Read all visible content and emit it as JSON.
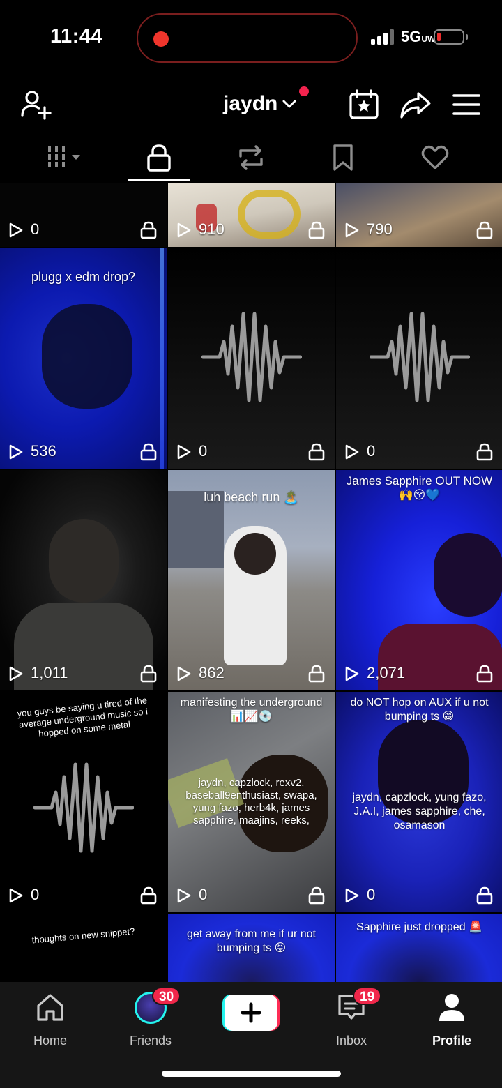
{
  "status_bar": {
    "time": "11:44",
    "network": "5G",
    "network_suffix": "UW",
    "battery_level": 0.1
  },
  "header": {
    "username": "jaydn",
    "icons": [
      "add-friend-icon",
      "calendar-star-icon",
      "share-icon",
      "menu-icon"
    ]
  },
  "tabs": [
    {
      "name": "videos",
      "icon": "grid-icon"
    },
    {
      "name": "private",
      "icon": "lock-icon",
      "active": true
    },
    {
      "name": "reposts",
      "icon": "repost-icon"
    },
    {
      "name": "favorites",
      "icon": "bookmark-icon"
    },
    {
      "name": "liked",
      "icon": "heart-icon"
    }
  ],
  "videos": [
    {
      "count": "0",
      "caption": ""
    },
    {
      "count": "910",
      "caption": ""
    },
    {
      "count": "790",
      "caption": ""
    },
    {
      "count": "536",
      "caption": "plugg x edm drop?"
    },
    {
      "count": "0",
      "caption": ""
    },
    {
      "count": "0",
      "caption": ""
    },
    {
      "count": "1,011",
      "caption": ""
    },
    {
      "count": "862",
      "caption": "luh beach run 🏝️"
    },
    {
      "count": "2,071",
      "caption": "James Sapphire OUT NOW 🙌😚💙"
    },
    {
      "count": "0",
      "caption": "you guys be saying u tired of the average underground music so i hopped on some metal"
    },
    {
      "count": "0",
      "caption": "manifesting the underground 📊📈💿",
      "caption2": "jaydn, capzlock, rexv2, baseball9enthusiast, swapa, yung fazo, herb4k, james sapphire, maajins, reeks,"
    },
    {
      "count": "0",
      "caption": "do NOT hop on AUX if u not bumping ts 😁",
      "caption2": "jaydn, capzlock, yung fazo, J.A.I, james sapphire, che, osamason"
    },
    {
      "caption": "thoughts on new snippet?"
    },
    {
      "caption": "get away from me if ur not bumping ts 😝"
    },
    {
      "caption": "Sapphire just dropped 🚨"
    }
  ],
  "bottom_nav": {
    "home": "Home",
    "friends": "Friends",
    "friends_badge": "30",
    "inbox": "Inbox",
    "inbox_badge": "19",
    "profile": "Profile"
  },
  "colors": {
    "accent_red": "#f0274a",
    "cyan": "#25f4ee",
    "background": "#000000"
  }
}
